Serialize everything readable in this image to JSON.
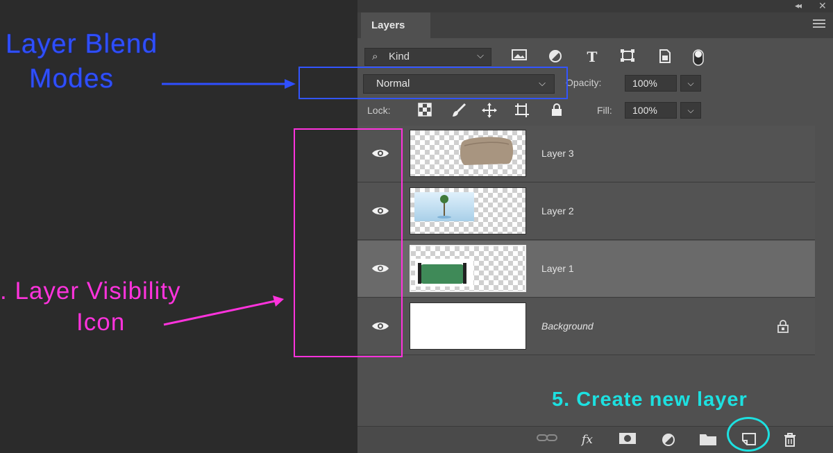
{
  "panel": {
    "tab_label": "Layers",
    "filter": {
      "label": "Kind"
    },
    "blend_mode": {
      "value": "Normal"
    },
    "opacity": {
      "label": "Opacity:",
      "value": "100%"
    },
    "lock": {
      "label": "Lock:"
    },
    "fill": {
      "label": "Fill:",
      "value": "100%"
    },
    "layers": [
      {
        "name": "Layer 3",
        "visible": true,
        "selected": false,
        "thumbnail": "beige-bag"
      },
      {
        "name": "Layer 2",
        "visible": true,
        "selected": false,
        "thumbnail": "tree-sky"
      },
      {
        "name": "Layer 1",
        "visible": true,
        "selected": true,
        "thumbnail": "green-bag"
      },
      {
        "name": "Background",
        "visible": true,
        "selected": false,
        "locked": true,
        "thumbnail": "white"
      }
    ]
  },
  "annotations": {
    "blend_line1": "Layer Blend",
    "blend_line2": "Modes",
    "visibility_line1": ". Layer Visibility",
    "visibility_line2": "Icon",
    "create_layer": "5. Create new layer"
  },
  "colors": {
    "annotation_blue": "#2f4fff",
    "annotation_pink": "#ff33dd",
    "annotation_cyan": "#1de0e0",
    "panel_bg": "#505050",
    "selected_row": "#6a6a6a"
  },
  "icons": {
    "filter": [
      "image-filter-icon",
      "adjustment-filter-icon",
      "type-filter-icon",
      "shape-filter-icon",
      "smart-object-filter-icon",
      "filter-toggle-icon"
    ],
    "lock": [
      "lock-transparent-pixels-icon",
      "lock-image-pixels-icon",
      "lock-position-icon",
      "lock-artboard-icon",
      "lock-all-icon"
    ],
    "footer": [
      "link-layers-icon",
      "fx-icon",
      "layer-mask-icon",
      "adjustment-layer-icon",
      "group-folder-icon",
      "new-layer-icon",
      "delete-trash-icon"
    ]
  }
}
